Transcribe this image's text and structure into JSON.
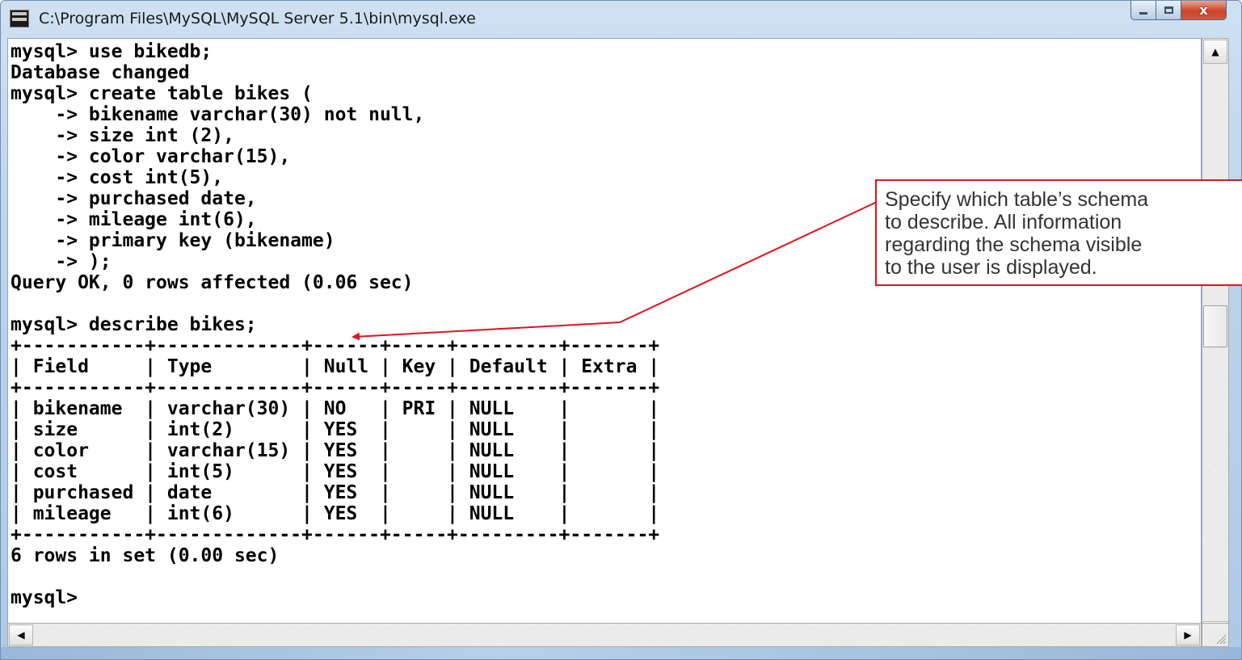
{
  "window": {
    "title": "C:\\Program Files\\MySQL\\MySQL Server 5.1\\bin\\mysql.exe",
    "controls": {
      "minimize": "minimize",
      "maximize": "maximize",
      "close": "x"
    }
  },
  "console": {
    "lines": [
      "mysql> use bikedb;",
      "Database changed",
      "mysql> create table bikes (",
      "    -> bikename varchar(30) not null,",
      "    -> size int (2),",
      "    -> color varchar(15),",
      "    -> cost int(5),",
      "    -> purchased date,",
      "    -> mileage int(6),",
      "    -> primary key (bikename)",
      "    -> );",
      "Query OK, 0 rows affected (0.06 sec)",
      "",
      "mysql> describe bikes;",
      "+-----------+-------------+------+-----+---------+-------+",
      "| Field     | Type        | Null | Key | Default | Extra |",
      "+-----------+-------------+------+-----+---------+-------+",
      "| bikename  | varchar(30) | NO   | PRI | NULL    |       |",
      "| size      | int(2)      | YES  |     | NULL    |       |",
      "| color     | varchar(15) | YES  |     | NULL    |       |",
      "| cost      | int(5)      | YES  |     | NULL    |       |",
      "| purchased | date        | YES  |     | NULL    |       |",
      "| mileage   | int(6)      | YES  |     | NULL    |       |",
      "+-----------+-------------+------+-----+---------+-------+",
      "6 rows in set (0.00 sec)",
      "",
      "mysql>"
    ]
  },
  "callout": {
    "lines": [
      "Specify which table’s schema",
      "to describe.  All information",
      "regarding the schema visible",
      "to the user is displayed."
    ],
    "color": "#e0141e"
  },
  "scrollbars": {
    "up": "▲",
    "down": "▼",
    "left": "◀",
    "right": "▶"
  }
}
